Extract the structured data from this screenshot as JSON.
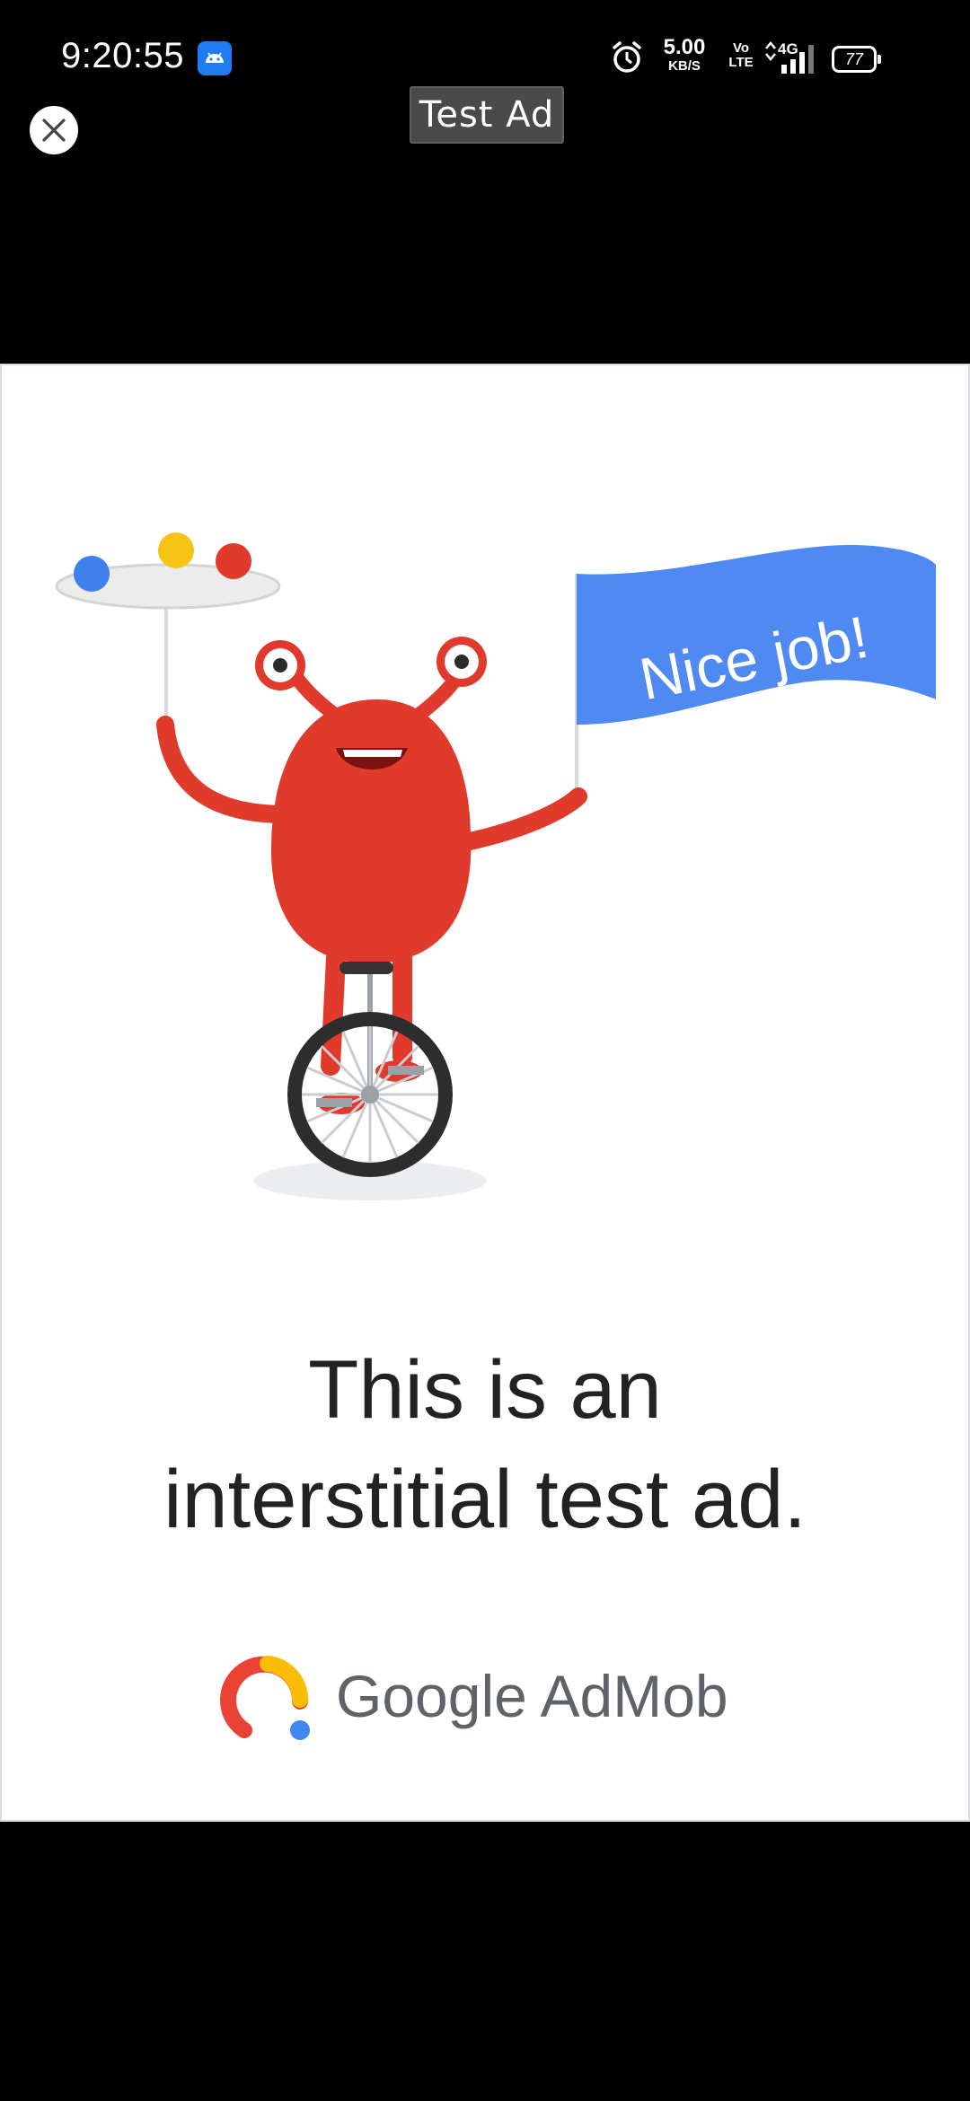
{
  "status_bar": {
    "time": "9:20:55",
    "network_speed": "5.00",
    "network_speed_unit": "KB/S",
    "volte_top": "Vo",
    "volte_bottom": "LTE",
    "network_type": "4G",
    "battery_level": "77",
    "icons": [
      "app-notification-icon",
      "alarm-icon",
      "signal-icon",
      "battery-icon"
    ]
  },
  "ad": {
    "label": "Test Ad",
    "close_icon": "close-icon",
    "flag_text": "Nice job!",
    "headline_line1": "This is an",
    "headline_line2": "interstitial test ad.",
    "brand": "Google AdMob"
  },
  "colors": {
    "background": "#000000",
    "card": "#ffffff",
    "monster_red": "#e03a2c",
    "flag_blue": "#4f8af2",
    "ball_blue": "#3f80ee",
    "ball_yellow": "#f7c416",
    "ball_red": "#e23a2a"
  }
}
